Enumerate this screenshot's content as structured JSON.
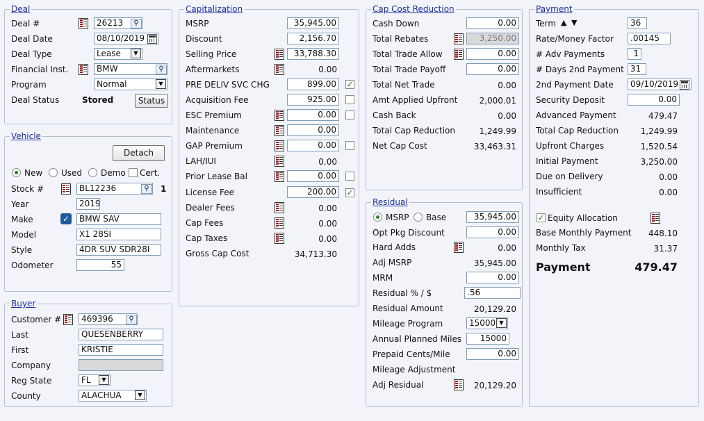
{
  "deal": {
    "title": "Deal",
    "deal_no_label": "Deal #",
    "deal_no": "26213",
    "deal_date_label": "Deal Date",
    "deal_date": "08/10/2019",
    "deal_type_label": "Deal Type",
    "deal_type": "Lease",
    "fin_inst_label": "Financial Inst.",
    "fin_inst": "BMW",
    "program_label": "Program",
    "program": "Normal",
    "status_label": "Deal Status",
    "status": "Stored",
    "status_button": "Status"
  },
  "vehicle": {
    "title": "Vehicle",
    "detach_button": "Detach",
    "opt_new": "New",
    "opt_used": "Used",
    "opt_demo": "Demo",
    "opt_cert": "Cert.",
    "stock_label": "Stock #",
    "stock": "BL12236",
    "stock_count": "1",
    "year_label": "Year",
    "year": "2019",
    "make_label": "Make",
    "make": "BMW SAV",
    "model_label": "Model",
    "model": "X1 28SI",
    "style_label": "Style",
    "style": "4DR SUV SDR28I",
    "odometer_label": "Odometer",
    "odometer": "55"
  },
  "buyer": {
    "title": "Buyer",
    "customer_label": "Customer #",
    "customer": "469396",
    "last_label": "Last",
    "last": "QUESENBERRY",
    "first_label": "First",
    "first": "KRISTIE",
    "company_label": "Company",
    "company": "",
    "reg_state_label": "Reg State",
    "reg_state": "FL",
    "county_label": "County",
    "county": "ALACHUA"
  },
  "cap": {
    "title": "Capitalization",
    "msrp_label": "MSRP",
    "msrp": "35,945.00",
    "discount_label": "Discount",
    "discount": "2,156.70",
    "selling_label": "Selling Price",
    "selling": "33,788.30",
    "after_label": "Aftermarkets",
    "after": "0.00",
    "prediv_label": "PRE DELIV SVC CHG",
    "prediv": "899.00",
    "acq_label": "Acquisition Fee",
    "acq": "925.00",
    "esc_label": "ESC Premium",
    "esc": "0.00",
    "maint_label": "Maintenance",
    "maint": "0.00",
    "gap_label": "GAP Premium",
    "gap": "0.00",
    "lah_label": "LAH/IUI",
    "lah": "0.00",
    "prior_label": "Prior Lease Bal",
    "prior": "0.00",
    "license_label": "License Fee",
    "license": "200.00",
    "dealer_label": "Dealer Fees",
    "dealer": "0.00",
    "capfees_label": "Cap Fees",
    "capfees": "0.00",
    "captax_label": "Cap Taxes",
    "captax": "0.00",
    "gross_label": "Gross Cap Cost",
    "gross": "34,713.30"
  },
  "ccr": {
    "title": "Cap Cost Reduction",
    "cash_down_label": "Cash Down",
    "cash_down": "0.00",
    "rebates_label": "Total Rebates",
    "rebates": "3,250.00",
    "trade_allow_label": "Total Trade Allow",
    "trade_allow": "0.00",
    "trade_payoff_label": "Total Trade Payoff",
    "trade_payoff": "0.00",
    "net_trade_label": "Total Net Trade",
    "net_trade": "0.00",
    "amt_applied_label": "Amt Applied Upfront",
    "amt_applied": "2,000.01",
    "cash_back_label": "Cash Back",
    "cash_back": "0.00",
    "total_red_label": "Total Cap Reduction",
    "total_red": "1,249.99",
    "net_cap_label": "Net Cap Cost",
    "net_cap": "33,463.31"
  },
  "residual": {
    "title": "Residual",
    "opt_msrp": "MSRP",
    "opt_base": "Base",
    "msrp_val": "35,945.00",
    "opt_pkg_label": "Opt Pkg Discount",
    "opt_pkg": "0.00",
    "hard_adds_label": "Hard Adds",
    "hard_adds": "0.00",
    "adj_msrp_label": "Adj MSRP",
    "adj_msrp": "35,945.00",
    "mrm_label": "MRM",
    "mrm": "0.00",
    "pct_label": "Residual % / $",
    "pct": ".56",
    "amount_label": "Residual Amount",
    "amount": "20,129.20",
    "mileage_prog_label": "Mileage Program",
    "mileage_prog": "15000",
    "annual_label": "Annual Planned Miles",
    "annual": "15000",
    "prepaid_label": "Prepaid Cents/Mile",
    "prepaid": "0.00",
    "mileage_adj_label": "Mileage Adjustment",
    "adj_residual_label": "Adj Residual",
    "adj_residual": "20,129.20"
  },
  "payment": {
    "title": "Payment",
    "term_label": "Term",
    "term": "36",
    "rate_label": "Rate/Money Factor",
    "rate": ".00145",
    "adv_label": "# Adv Payments",
    "adv": "1",
    "days_label": "# Days 2nd Payment",
    "days": "31",
    "date2_label": "2nd Payment Date",
    "date2": "09/10/2019",
    "security_label": "Security Deposit",
    "security": "0.00",
    "advanced_label": "Advanced Payment",
    "advanced": "479.47",
    "total_red_label": "Total Cap Reduction",
    "total_red": "1,249.99",
    "upfront_label": "Upfront Charges",
    "upfront": "1,520.54",
    "initial_label": "Initial Payment",
    "initial": "3,250.00",
    "due_label": "Due on Delivery",
    "due": "0.00",
    "insufficient_label": "Insufficient",
    "insufficient": "0.00",
    "equity_label": "Equity Allocation",
    "base_label": "Base Monthly Payment",
    "base": "448.10",
    "tax_label": "Monthly Tax",
    "tax": "31.37",
    "payment_label": "Payment",
    "payment": "479.47"
  }
}
